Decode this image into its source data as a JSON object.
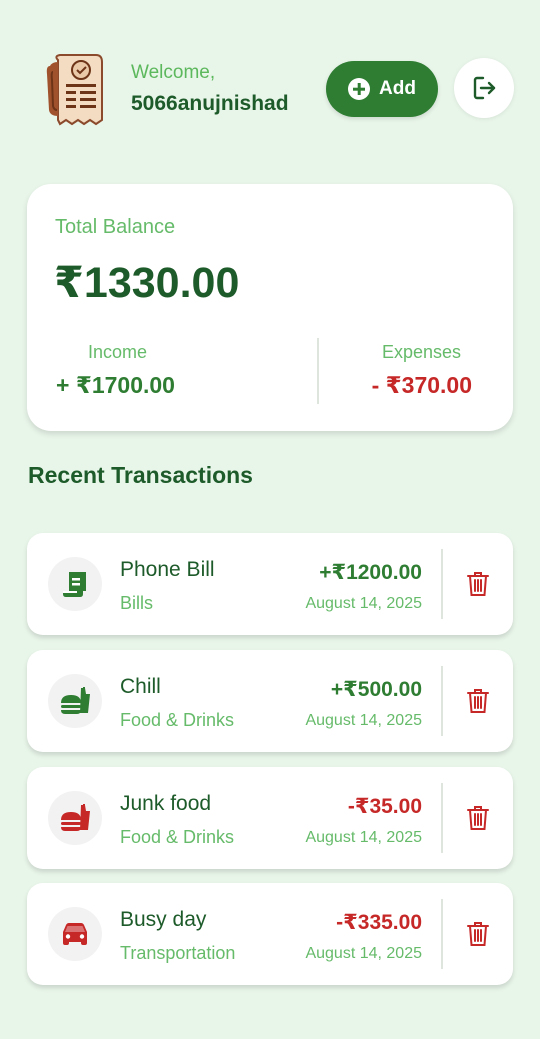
{
  "header": {
    "welcome": "Welcome,",
    "username": "5066anujnishad",
    "add_label": "Add"
  },
  "balance": {
    "label": "Total Balance",
    "amount": "₹1330.00",
    "income_label": "Income",
    "income_amount": "+ ₹1700.00",
    "expenses_label": "Expenses",
    "expenses_amount": "- ₹370.00"
  },
  "section_title": "Recent Transactions",
  "transactions": [
    {
      "title": "Phone Bill",
      "category": "Bills",
      "amount": "+₹1200.00",
      "date": "August 14, 2025",
      "icon": "bill-icon",
      "color": "#2e7d32"
    },
    {
      "title": "Chill",
      "category": "Food & Drinks",
      "amount": "+₹500.00",
      "date": "August 14, 2025",
      "icon": "fastfood-icon",
      "color": "#2e7d32"
    },
    {
      "title": "Junk food",
      "category": "Food & Drinks",
      "amount": "-₹35.00",
      "date": "August 14, 2025",
      "icon": "fastfood-icon",
      "color": "#c62828"
    },
    {
      "title": "Busy day",
      "category": "Transportation",
      "amount": "-₹335.00",
      "date": "August 14, 2025",
      "icon": "car-icon",
      "color": "#c62828"
    }
  ],
  "colors": {
    "background": "#e8f5e9",
    "primary": "#2e7d32",
    "income": "#2e7d32",
    "expense": "#c62828",
    "accent_text": "#66bb6a"
  }
}
